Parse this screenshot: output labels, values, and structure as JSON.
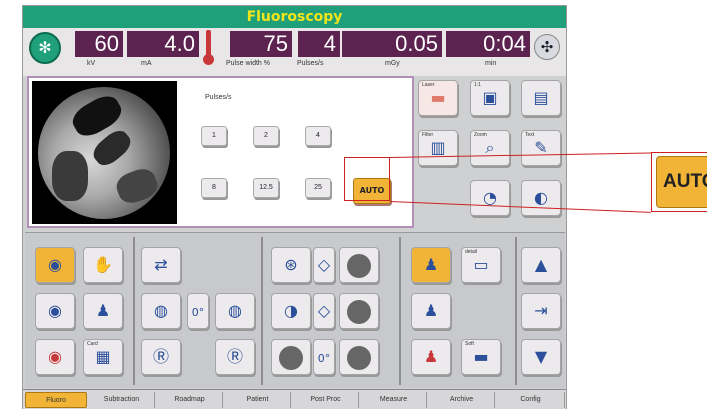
{
  "title": "Fluoroscopy",
  "params": [
    {
      "value": "60",
      "unit": "kV"
    },
    {
      "value": "4.0",
      "unit": "mA"
    },
    {
      "value": "75",
      "unit": "Pulse width %"
    },
    {
      "value": "4",
      "unit": "Pulses/s"
    },
    {
      "value": "0.05",
      "unit": "mGy"
    },
    {
      "value": "0:04",
      "unit": "min"
    }
  ],
  "pulses_label": "Pulses/s",
  "pulse_buttons": [
    "1",
    "2",
    "4",
    "8",
    "12.5",
    "25"
  ],
  "auto_label": "AUTO",
  "callout_label": "AUTO",
  "tool_labels": {
    "laser": "Laser",
    "collimation": "1:1",
    "filter": "Filter",
    "zoom": "Zoom",
    "text": "Text",
    "card": "Card",
    "detail": "detail",
    "soft": "Soft"
  },
  "tabs": [
    "Fluoro",
    "Subtraction",
    "Roadmap",
    "Patient",
    "Post Proc",
    "Measure",
    "Archive",
    "Config"
  ],
  "colors": {
    "title_bg": "#1fa07a",
    "title_text": "#f2e61a",
    "param_bg": "#5c2350",
    "accent": "#f2b437",
    "callout_border": "#cc2222"
  }
}
